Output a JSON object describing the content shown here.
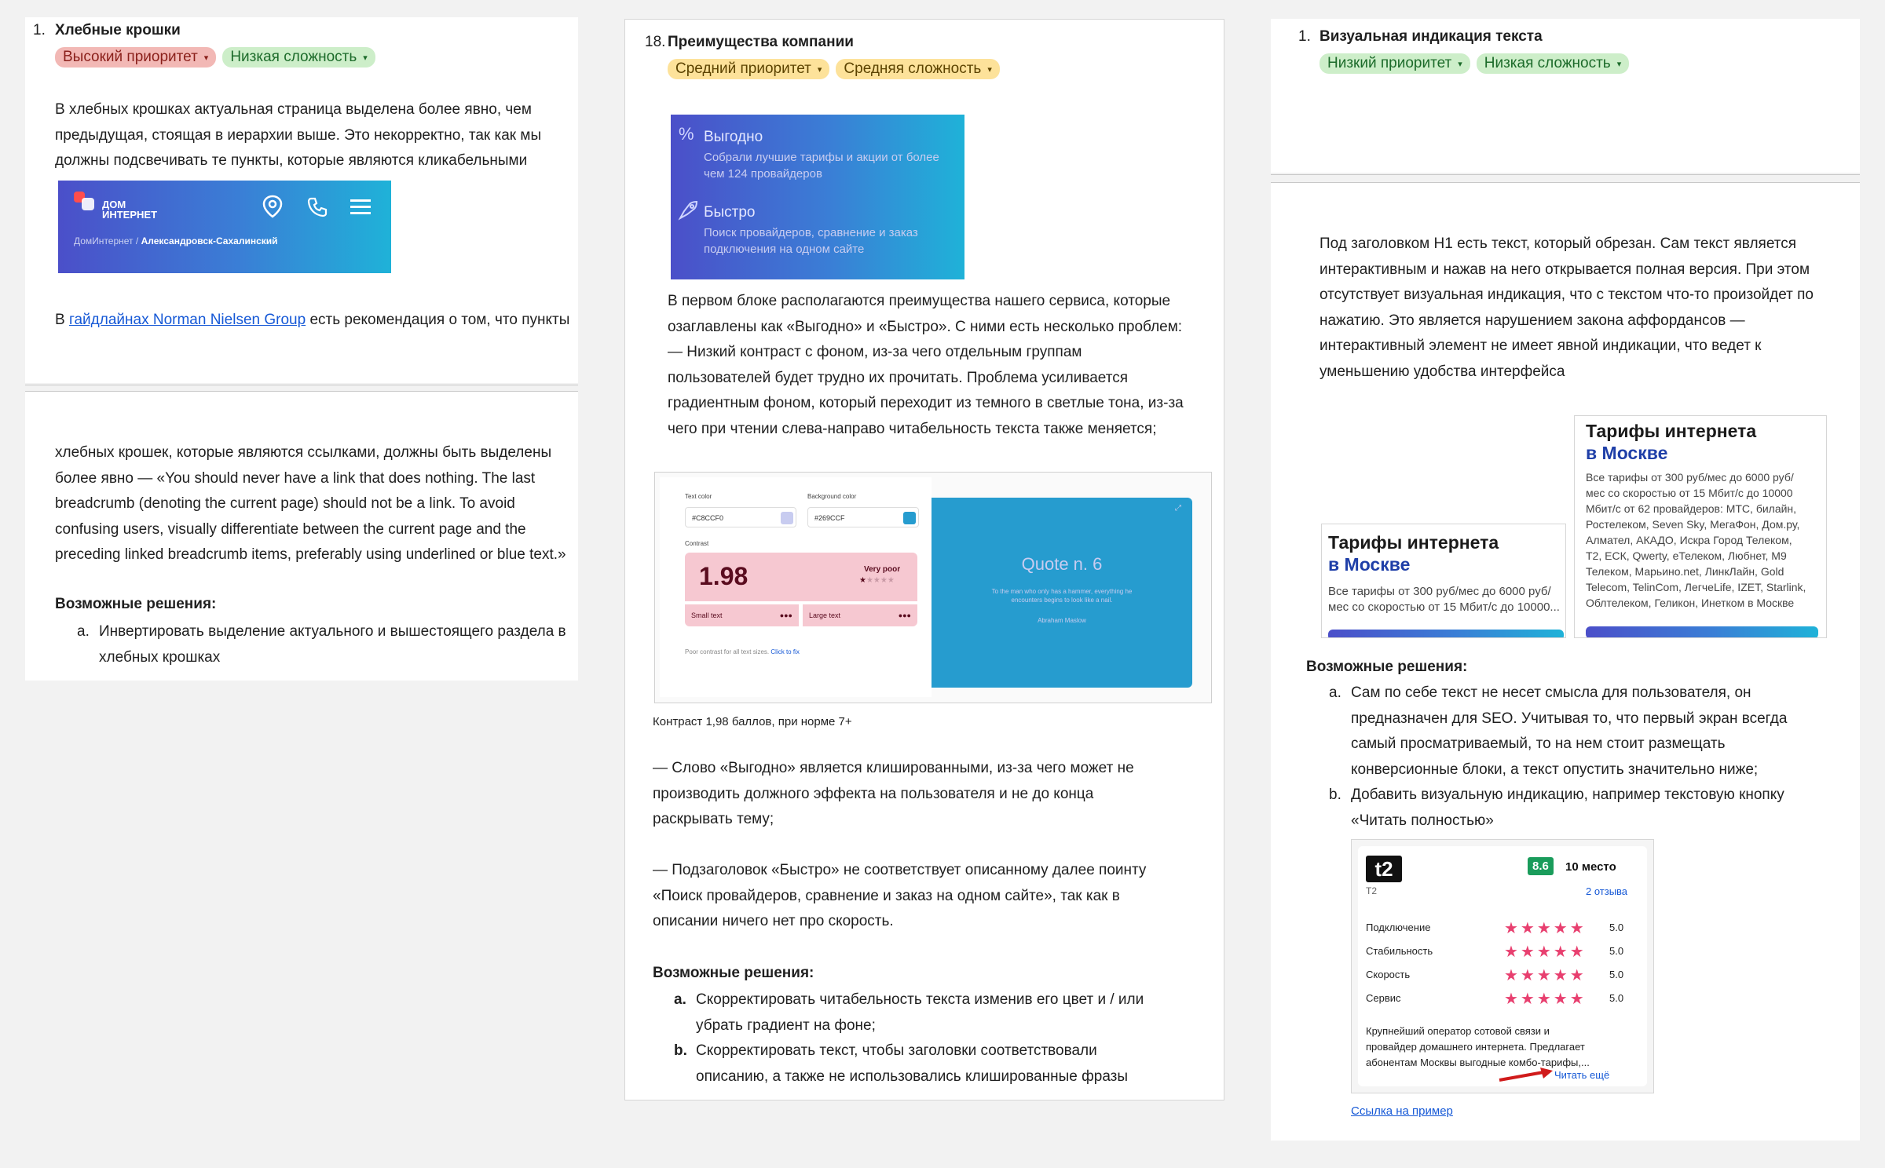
{
  "left": {
    "num": "1.",
    "title": "Хлебные крошки",
    "chip1": "Высокий приоритет",
    "chip2": "Низкая сложность",
    "para1_l1": "В хлебных крошках актуальная страница выделена более явно, чем",
    "para1_l2": "предыдущая, стоящая в иерархии выше. Это некорректно, так как мы",
    "para1_l3": "должны подсвечивать те пункты, которые являются кликабельными",
    "banner_brand1": "ДОМ",
    "banner_brand2": "ИНТЕРНЕТ",
    "banner_crumb1": "ДомИнтернет /",
    "banner_crumb2": "Александровск-Сахалинский",
    "para2_pre": "В",
    "para2_link": "гайдлайнах Norman Nielsen Group",
    "para2_post": "есть рекомендация о том, что пункты",
    "para3_l1": "хлебных крошек, которые являются ссылками, должны быть выделены",
    "para3_l2": "более явно — «You should never have a link that does nothing. The last",
    "para3_l3": "breadcrumb (denoting the current page) should not be a link. To avoid",
    "para3_l4": "confusing users, visually differentiate between the current page and the",
    "para3_l5": "preceding linked breadcrumb items, preferably using underlined or blue text.»",
    "solutions": "Возможные решения:",
    "sol_a_marker": "a.",
    "sol_a_l1": "Инвертировать выделение актуального и вышестоящего раздела в",
    "sol_a_l2": "хлебных крошках"
  },
  "middle": {
    "num": "18.",
    "title": "Преимущества компании",
    "chip1": "Средний приоритет",
    "chip2": "Средняя сложность",
    "card1_title": "Выгодно",
    "card1_l1": "Собрали лучшие тарифы и акции от более",
    "card1_l2": "чем 124 провайдеров",
    "card2_title": "Быстро",
    "card2_l1": "Поиск провайдеров, сравнение и заказ",
    "card2_l2": "подключения на одном сайте",
    "p1_l1": "В первом блоке располагаются преимущества нашего сервиса, которые",
    "p1_l2": "озаглавлены как «Выгодно» и «Быстро». С ними есть несколько проблем:",
    "p1_l3": "— Низкий контраст с фоном, из-за чего отдельным группам",
    "p1_l4": "пользователей будет трудно их прочитать. Проблема усиливается",
    "p1_l5": "градиентным фоном, который переходит из темного в светлые тона, из-за",
    "p1_l6": "чего при чтении слева-направо читабельность текста также меняется;",
    "cc_text_color": "Text color",
    "cc_bg_color": "Background color",
    "cc_text_val": "#C8CCF0",
    "cc_bg_val": "#269CCF",
    "cc_contrast": "Contrast",
    "cc_ratio": "1.98",
    "cc_rating": "Very poor",
    "cc_small": "Small text",
    "cc_large": "Large text",
    "cc_footer": "Poor contrast for all text sizes.",
    "cc_fix": "Click to fix",
    "cc_quote": "Quote n. 6",
    "cc_quote_l1": "To the man who only has a hammer, everything he",
    "cc_quote_l2": "encounters begins to look like a nail.",
    "cc_author": "Abraham Maslow",
    "caption": "Контраст 1,98 баллов, при норме 7+",
    "p2_l1": "— Слово «Выгодно» является клишированными, из-за чего может не",
    "p2_l2": "производить должного эффекта на пользователя и не до конца",
    "p2_l3": "раскрывать тему;",
    "p3_l1": "— Подзаголовок «Быстро» не соответствует описанному далее поинту",
    "p3_l2": "«Поиск провайдеров, сравнение и заказ на одном сайте», так как в",
    "p3_l3": "описании ничего нет про скорость.",
    "solutions": "Возможные решения:",
    "sol_a_marker": "a.",
    "sol_a_l1": "Скорректировать читабельность текста изменив его цвет и / или",
    "sol_a_l2": "убрать градиент на фоне;",
    "sol_b_marker": "b.",
    "sol_b_l1": "Скорректировать текст, чтобы заголовки соответствовали",
    "sol_b_l2": "описанию, а также не использовались клишированные фразы"
  },
  "right": {
    "num": "1.",
    "title": "Визуальная индикация текста",
    "chip1": "Низкий приоритет",
    "chip2": "Низкая сложность",
    "p1_l1": "Под заголовком H1 есть текст, который обрезан. Сам текст является",
    "p1_l2": "интерактивным и нажав на него открывается полная версия. При этом",
    "p1_l3": "отсутствует визуальная индикация, что с текстом что-то произойдет по",
    "p1_l4": "нажатию. Это является нарушением закона аффордансов —",
    "p1_l5": "интерактивный элемент не имеет явной индикации, что ведет к",
    "p1_l6": "уменьшению удобства интерфейса",
    "s1_title": "Тарифы интернета",
    "s1_sub": "в Москве",
    "s1_l1": "Все тарифы от 300 руб/мес до 6000 руб/",
    "s1_l2": "мес со скоростью от 15 Мбит/с до 10000...",
    "s2_title": "Тарифы интернета",
    "s2_sub": "в Москве",
    "s2_l1": "Все тарифы от 300 руб/мес до 6000 руб/",
    "s2_l2": "мес со скоростью от 15 Мбит/с до 10000",
    "s2_l3": "Мбит/с от 62 провайдеров: МТС, билайн,",
    "s2_l4": "Ростелеком, Seven Sky, МегаФон, Дом.ру,",
    "s2_l5": "Алмател, АКАДО, Искра Город Телеком,",
    "s2_l6": "Т2, ЕСК, Qwerty, еТелеком, Любнет, М9",
    "s2_l7": "Телеком, Марьино.net, ЛинкЛайн, Gold",
    "s2_l8": "Telecom, TelinCom, ЛегчеLife, IZET, Starlink,",
    "s2_l9": "Облтелеком, Геликон, Инетком в Москве",
    "solutions": "Возможные решения:",
    "sol_a_marker": "a.",
    "sol_a_l1": "Сам по себе текст не несет смысла для пользователя, он",
    "sol_a_l2": "предназначен для SEO. Учитывая то, что первый экран всегда",
    "sol_a_l3": "самый просматриваемый, то на нем стоит размещать",
    "sol_a_l4": "конверсионные блоки, а текст опустить значительно ниже;",
    "sol_b_marker": "b.",
    "sol_b_l1": "Добавить визуальную индикацию, например текстовую кнопку",
    "sol_b_l2": "«Читать полностью»",
    "t2_logo": "t2",
    "t2_name": "T2",
    "t2_score": "8.6",
    "t2_rank": "10 место",
    "t2_reviews": "2 отзыва",
    "t2_rows": [
      {
        "label": "Подключение",
        "score": "5.0"
      },
      {
        "label": "Стабильность",
        "score": "5.0"
      },
      {
        "label": "Скорость",
        "score": "5.0"
      },
      {
        "label": "Сервис",
        "score": "5.0"
      }
    ],
    "t2_desc_l1": "Крупнейший оператор сотовой связи и",
    "t2_desc_l2": "провайдер домашнего интернета. Предлагает",
    "t2_desc_l3": "абонентам Москвы выгодные комбо-тарифы,...",
    "t2_read_more": "Читать ещё",
    "example_link": "Ссылка на пример"
  },
  "colors": {
    "high": "#f2b8b5",
    "low": "#cdeec9",
    "medium": "#fde29a",
    "star": "#e83f6f",
    "score_badge": "#1a9c5b"
  }
}
